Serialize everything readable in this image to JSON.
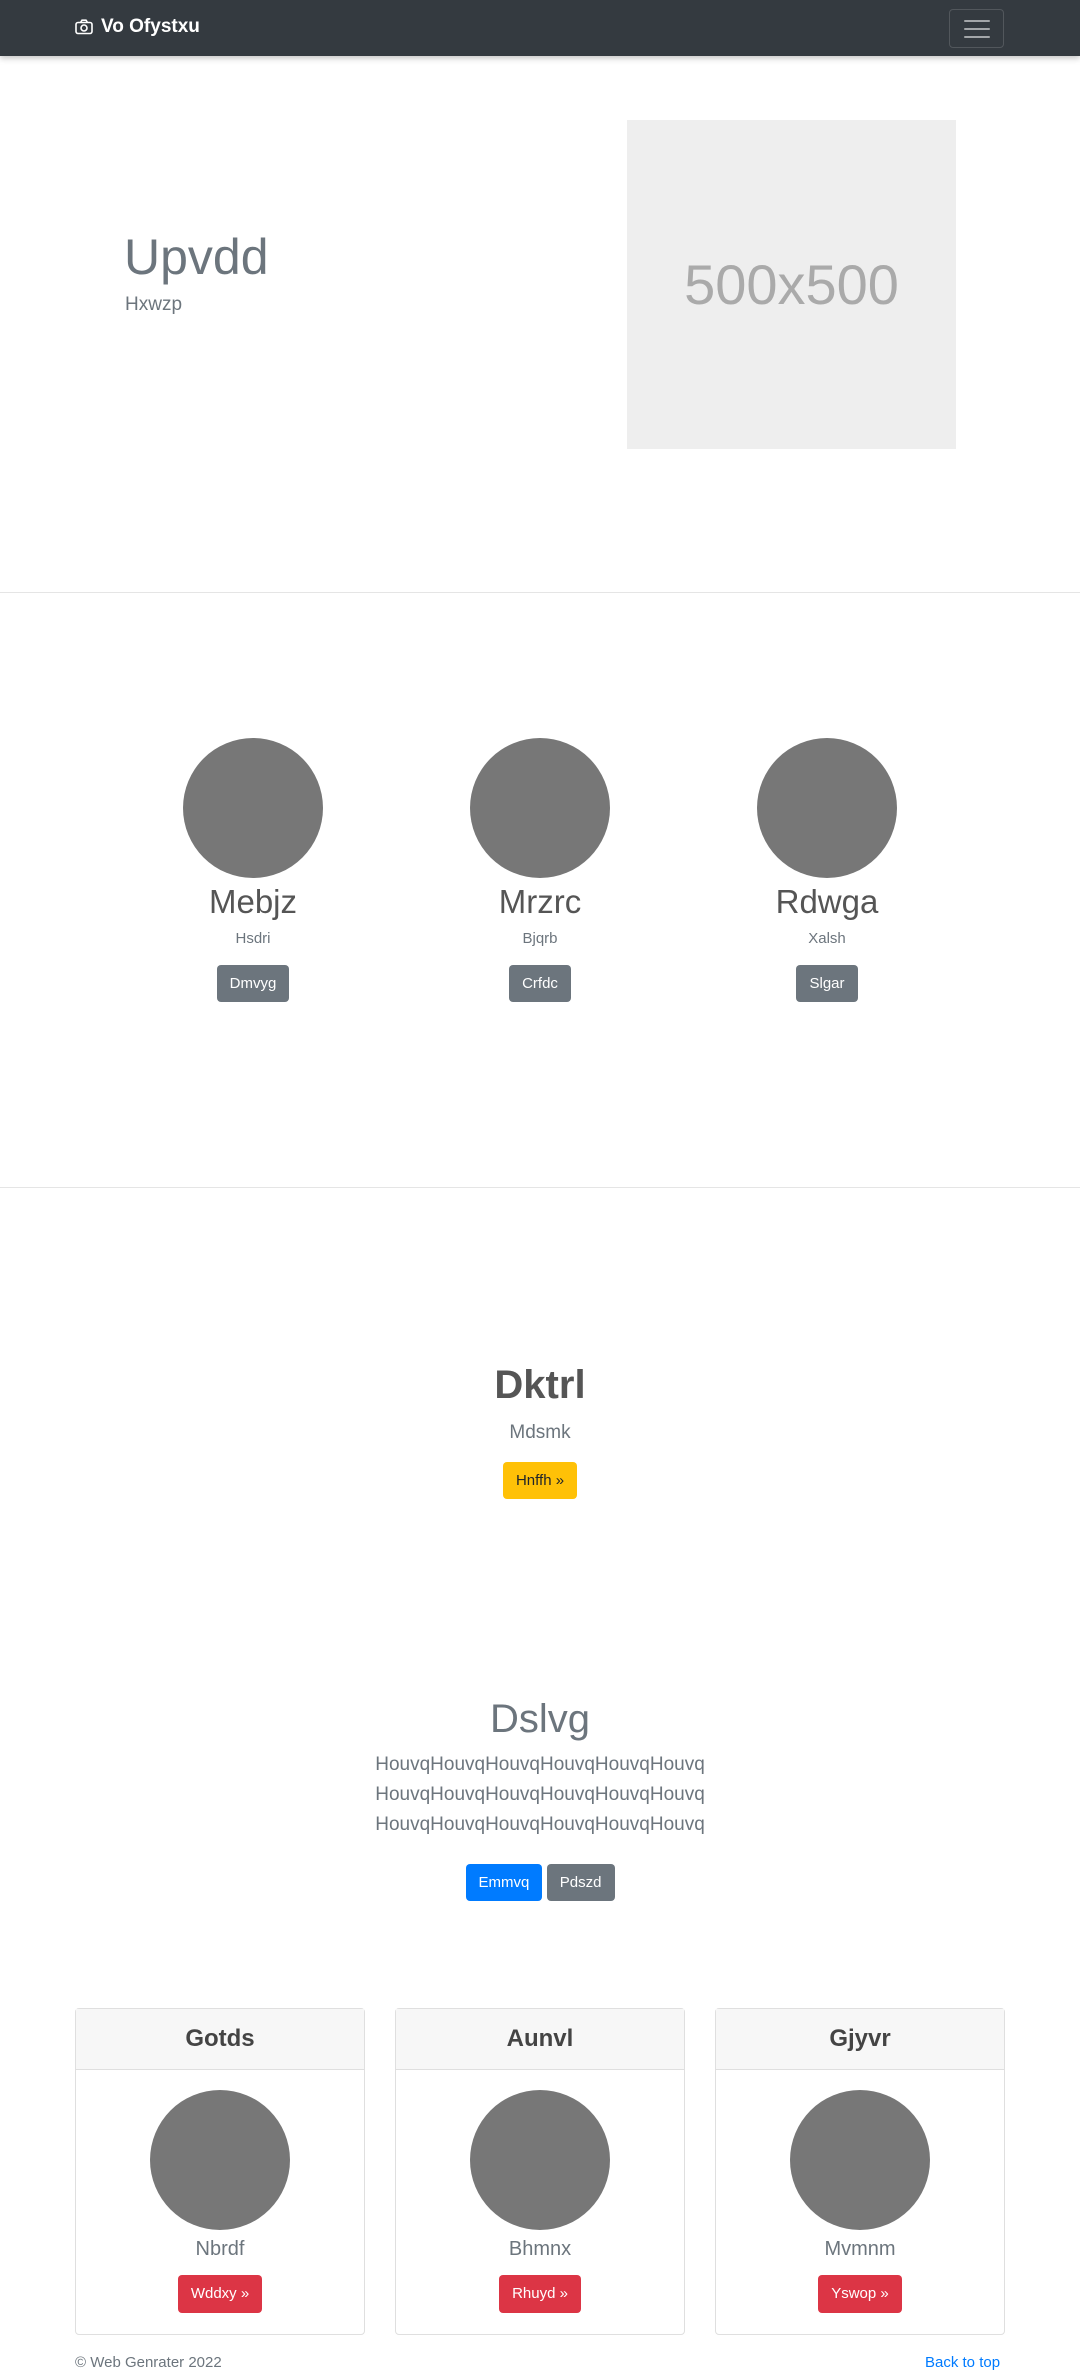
{
  "navbar": {
    "brand": "Vo Ofystxu",
    "brand_icon": "camera-icon",
    "toggler_icon": "hamburger-icon"
  },
  "hero": {
    "title": "Upvdd",
    "subtitle": "Hxwzp",
    "placeholder_text": "500x500"
  },
  "team": [
    {
      "name": "Mebjz",
      "sub": "Hsdri",
      "button": "Dmvyg"
    },
    {
      "name": "Mrzrc",
      "sub": "Bjqrb",
      "button": "Crfdc"
    },
    {
      "name": "Rdwga",
      "sub": "Xalsh",
      "button": "Slgar"
    }
  ],
  "feature": {
    "title": "Dktrl",
    "subtitle": "Mdsmk",
    "button": "Hnffh »"
  },
  "block": {
    "title": "Dslvg",
    "lines": [
      "HouvqHouvqHouvqHouvqHouvqHouvq",
      "HouvqHouvqHouvqHouvqHouvqHouvq",
      "HouvqHouvqHouvqHouvqHouvqHouvq"
    ],
    "primary_button": "Emmvq",
    "secondary_button": "Pdszd"
  },
  "cards": [
    {
      "header": "Gotds",
      "sub": "Nbrdf",
      "button": "Wddxy »"
    },
    {
      "header": "Aunvl",
      "sub": "Bhmnx",
      "button": "Rhuyd »"
    },
    {
      "header": "Gjyvr",
      "sub": "Mvmnm",
      "button": "Yswop »"
    }
  ],
  "footer": {
    "copyright": "© Web Genrater 2022",
    "back_to_top": "Back to top"
  },
  "colors": {
    "navbar": "#343a40",
    "secondary": "#6c757d",
    "warning": "#ffc107",
    "primary": "#007bff",
    "danger": "#dc3545"
  }
}
